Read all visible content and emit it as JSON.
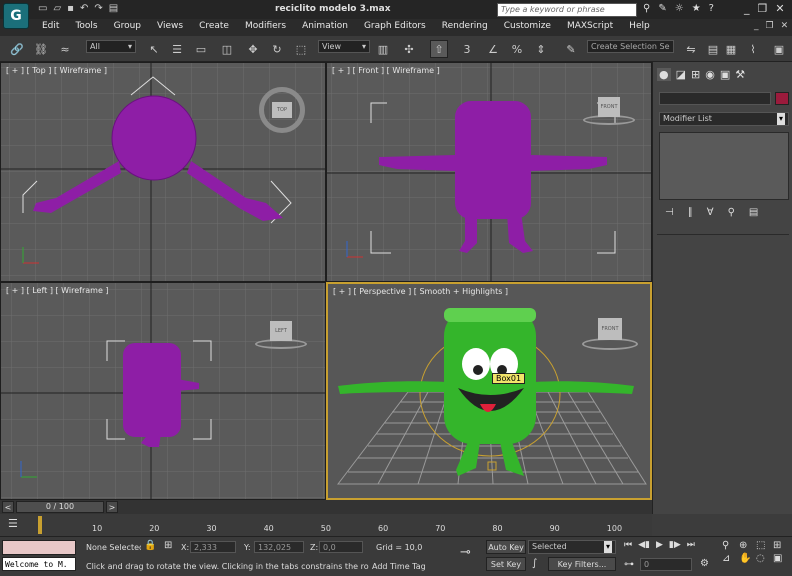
{
  "window": {
    "title": "reciclito modelo 3.max",
    "search_placeholder": "Type a keyword or phrase"
  },
  "menu": [
    "Edit",
    "Tools",
    "Group",
    "Views",
    "Create",
    "Modifiers",
    "Animation",
    "Graph Editors",
    "Rendering",
    "Customize",
    "MAXScript",
    "Help"
  ],
  "toolbar": {
    "filter_value": "All",
    "refcoord_value": "View",
    "named_selection_placeholder": "Create Selection Se"
  },
  "viewports": {
    "top": {
      "label": "[ + ] [ Top ] [ Wireframe ]",
      "cube": "TOP"
    },
    "front": {
      "label": "[ + ] [ Front ] [ Wireframe ]",
      "cube": "FRONT"
    },
    "left": {
      "label": "[ + ] [ Left ] [ Wireframe ]",
      "cube": "LEFT"
    },
    "perspective": {
      "label": "[ + ] [ Perspective ] [ Smooth + Highlights ]",
      "cube": "FRONT",
      "tooltip": "Box01"
    }
  },
  "command_panel": {
    "modifier_list": "Modifier List",
    "color": "#9b1b3c"
  },
  "timeline": {
    "frame": "0 / 100",
    "ticks": [
      "0",
      "10",
      "20",
      "30",
      "40",
      "50",
      "60",
      "70",
      "80",
      "90",
      "100"
    ]
  },
  "status": {
    "maxscript_listener": "Welcome to M.",
    "selection": "None Selected",
    "x_label": "X:",
    "x_value": "2,333",
    "y_label": "Y:",
    "y_value": "132,025",
    "z_label": "Z:",
    "z_value": "0,0",
    "grid": "Grid = 10,0",
    "auto_key": "Auto Key",
    "set_key": "Set Key",
    "selected_value": "Selected",
    "key_filters": "Key Filters...",
    "prompt": "Click and drag to rotate the view.  Clicking in the tabs constrains the ro",
    "add_time_tag": "Add Time Tag",
    "frame_value": "0"
  },
  "colors": {
    "purple": "#8e1ea6",
    "green": "#34b52b",
    "bg": "#5a5a5a"
  }
}
